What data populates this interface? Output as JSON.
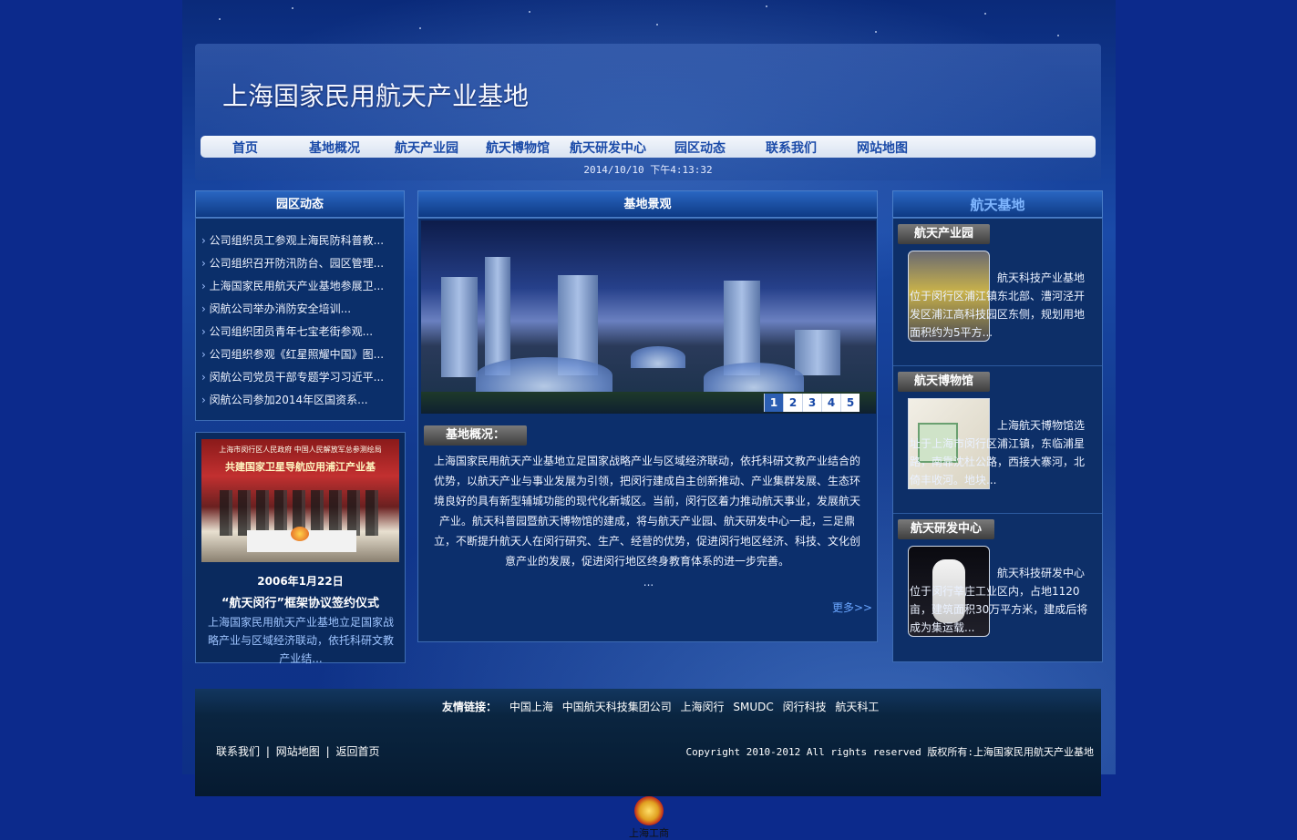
{
  "header": {
    "title": "上海国家民用航天产业基地",
    "datetime": "2014/10/10 下午4:13:32"
  },
  "nav": {
    "items": [
      "首页",
      "基地概况",
      "航天产业园",
      "航天博物馆",
      "航天研发中心",
      "园区动态",
      "联系我们",
      "网站地图"
    ]
  },
  "left": {
    "news_title": "园区动态",
    "news": [
      "公司组织员工参观上海民防科普教...",
      "公司组织召开防汛防台、园区管理...",
      "上海国家民用航天产业基地参展卫...",
      "闵航公司举办消防安全培训...",
      "公司组织团员青年七宝老街参观...",
      "公司组织参观《红星照耀中国》图...",
      "闵航公司党员干部专题学习习近平...",
      "闵航公司参加2014年区国资系..."
    ],
    "photo_banner_line1": "上海市闵行区人民政府      中国人民解放军总参测绘局",
    "photo_banner_line2": "共建国家卫星导航应用浦江产业基",
    "photo_date": "2006年1月22日",
    "photo_caption": "“航天闵行”框架协议签约仪式",
    "photo_desc": "上海国家民用航天产业基地立足国家战略产业与区域经济联动，依托科研文教产业结..."
  },
  "center": {
    "title": "基地景观",
    "pager": [
      "1",
      "2",
      "3",
      "4",
      "5"
    ],
    "active_page": "1",
    "overview_tag": "基地概况：",
    "overview_text": "上海国家民用航天产业基地立足国家战略产业与区域经济联动，依托科研文教产业结合的优势，以航天产业与事业发展为引领，把闵行建成自主创新推动、产业集群发展、生态环境良好的具有新型辅城功能的现代化新城区。当前，闵行区着力推动航天事业，发展航天产业。航天科普园暨航天博物馆的建成，将与航天产业园、航天研发中心一起，三足鼎立，不断提升航天人在闵行研究、生产、经营的优势，促进闵行地区经济、科技、文化创意产业的发展，促进闵行地区终身教育体系的进一步完善。",
    "ellipsis": "...",
    "more": "更多>>"
  },
  "right": {
    "title": "航天基地",
    "sections": [
      {
        "tag": "航天产业园",
        "text": "航天科技产业基地位于闵行区浦江镇东北部、漕河泾开发区浦江高科技园区东侧，规划用地面积约为5平方..."
      },
      {
        "tag": "航天博物馆",
        "text": "上海航天博物馆选址于上海市闵行区浦江镇，东临浦星路，南靠沈杜公路，西接大寨河，北倚丰收河。地块..."
      },
      {
        "tag": "航天研发中心",
        "text": "航天科技研发中心位于闵行莘庄工业区内，占地1120亩，建筑面积30万平方米，建成后将成为集运载..."
      }
    ]
  },
  "footer": {
    "links_label": "友情链接：",
    "links": [
      "中国上海",
      "中国航天科技集团公司",
      "上海闵行",
      "SMUDC",
      "闵行科技",
      "航天科工"
    ],
    "bottom_links": [
      "联系我们",
      "网站地图",
      "返回首页"
    ],
    "separator": "|",
    "copyright": "Copyright 2010-2012 All rights reserved 版权所有:上海国家民用航天产业基地",
    "badge_text": "上海工商"
  },
  "colors": {
    "page_bg": "#0c2a8c",
    "nav_text": "#1a4aa8",
    "panel_bg": "#0b2f6a",
    "footer_bg": "#061a30"
  }
}
